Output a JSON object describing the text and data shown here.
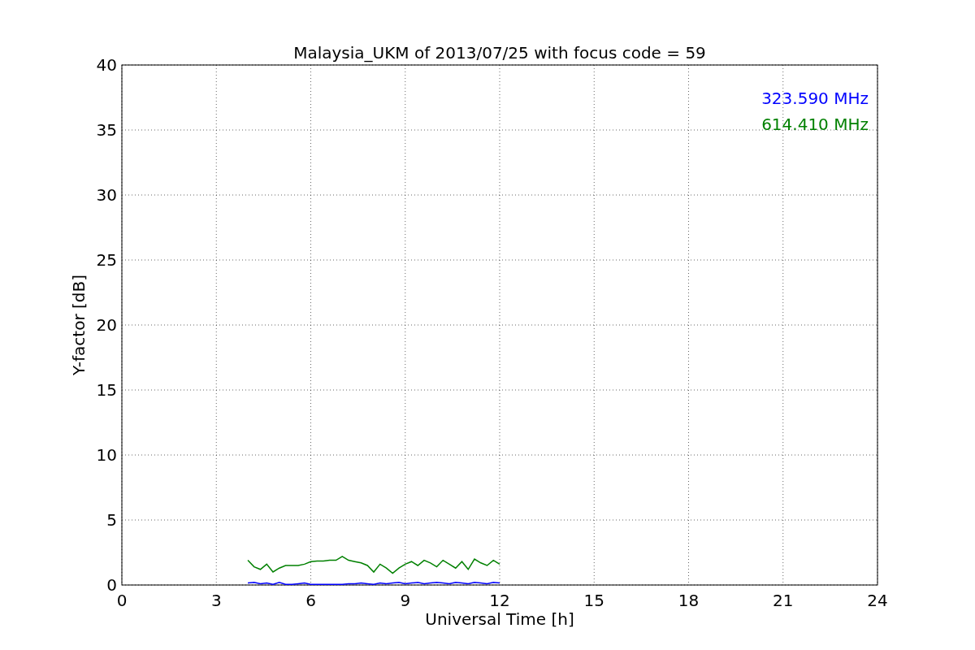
{
  "chart_data": {
    "type": "line",
    "title": "Malaysia_UKM of 2013/07/25 with focus code = 59",
    "xlabel": "Universal Time [h]",
    "ylabel": "Y-factor [dB]",
    "x": [
      4.0,
      4.2,
      4.4,
      4.6,
      4.8,
      5.0,
      5.2,
      5.4,
      5.6,
      5.8,
      6.0,
      6.2,
      6.4,
      6.6,
      6.8,
      7.0,
      7.2,
      7.4,
      7.6,
      7.8,
      8.0,
      8.2,
      8.4,
      8.6,
      8.8,
      9.0,
      9.2,
      9.4,
      9.6,
      9.8,
      10.0,
      10.2,
      10.4,
      10.6,
      10.8,
      11.0,
      11.2,
      11.4,
      11.6,
      11.8,
      12.0
    ],
    "series": [
      {
        "name": "323.590 MHz",
        "color": "#0000ff",
        "values": [
          0.15,
          0.2,
          0.1,
          0.15,
          0.05,
          0.2,
          0.05,
          0.05,
          0.1,
          0.15,
          0.05,
          0.05,
          0.05,
          0.05,
          0.05,
          0.05,
          0.1,
          0.1,
          0.15,
          0.1,
          0.05,
          0.15,
          0.1,
          0.15,
          0.2,
          0.1,
          0.15,
          0.2,
          0.1,
          0.15,
          0.2,
          0.15,
          0.1,
          0.2,
          0.15,
          0.1,
          0.2,
          0.15,
          0.1,
          0.2,
          0.15
        ]
      },
      {
        "name": "614.410 MHz",
        "color": "#008000",
        "values": [
          1.9,
          1.4,
          1.2,
          1.6,
          1.0,
          1.3,
          1.5,
          1.5,
          1.5,
          1.6,
          1.8,
          1.85,
          1.85,
          1.9,
          1.9,
          2.2,
          1.9,
          1.8,
          1.7,
          1.5,
          1.0,
          1.6,
          1.3,
          0.9,
          1.3,
          1.6,
          1.8,
          1.5,
          1.9,
          1.7,
          1.4,
          1.9,
          1.6,
          1.3,
          1.8,
          1.2,
          2.0,
          1.7,
          1.5,
          1.9,
          1.6
        ]
      }
    ],
    "xlim": [
      0,
      24
    ],
    "ylim": [
      0,
      40
    ],
    "xticks": [
      0,
      3,
      6,
      9,
      12,
      15,
      18,
      21,
      24
    ],
    "yticks": [
      0,
      5,
      10,
      15,
      20,
      25,
      30,
      35,
      40
    ],
    "grid": true
  }
}
